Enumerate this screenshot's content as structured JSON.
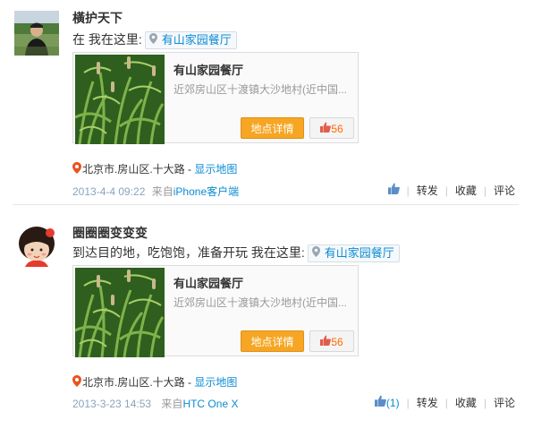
{
  "posts": [
    {
      "username": "橫护天下",
      "text_prefix": "在 我在这里:",
      "place": "有山家园餐厅",
      "card": {
        "name": "有山家园餐厅",
        "address": "近郊房山区十渡镇大沙地村(近中国...",
        "detail_label": "地点详情",
        "like_count": "56"
      },
      "location": "北京市.房山区.十大路",
      "location_sep": " - ",
      "show_map": "显示地图",
      "time": "2013-4-4 09:22",
      "from_prefix": "来自",
      "source": "iPhone客户端",
      "actions": {
        "like": "",
        "repost": "转发",
        "favorite": "收藏",
        "comment": "评论"
      }
    },
    {
      "username": "圈圈圈变变变",
      "text_prefix": "到达目的地，吃饱饱，准备开玩 我在这里:",
      "place": "有山家园餐厅",
      "card": {
        "name": "有山家园餐厅",
        "address": "近郊房山区十渡镇大沙地村(近中国...",
        "detail_label": "地点详情",
        "like_count": "56"
      },
      "location": "北京市.房山区.十大路",
      "location_sep": " - ",
      "show_map": "显示地图",
      "time": "2013-3-23 14:53",
      "from_prefix": "来自",
      "source": "HTC One X",
      "actions": {
        "like": "(1)",
        "repost": "转发",
        "favorite": "收藏",
        "comment": "评论"
      }
    }
  ],
  "colors": {
    "link": "#0a8cd2",
    "button": "#f6a623",
    "like": "#ff6a00",
    "pin": "#e8541e"
  },
  "icons": [
    "map-pin-icon",
    "thumbs-up-icon"
  ]
}
